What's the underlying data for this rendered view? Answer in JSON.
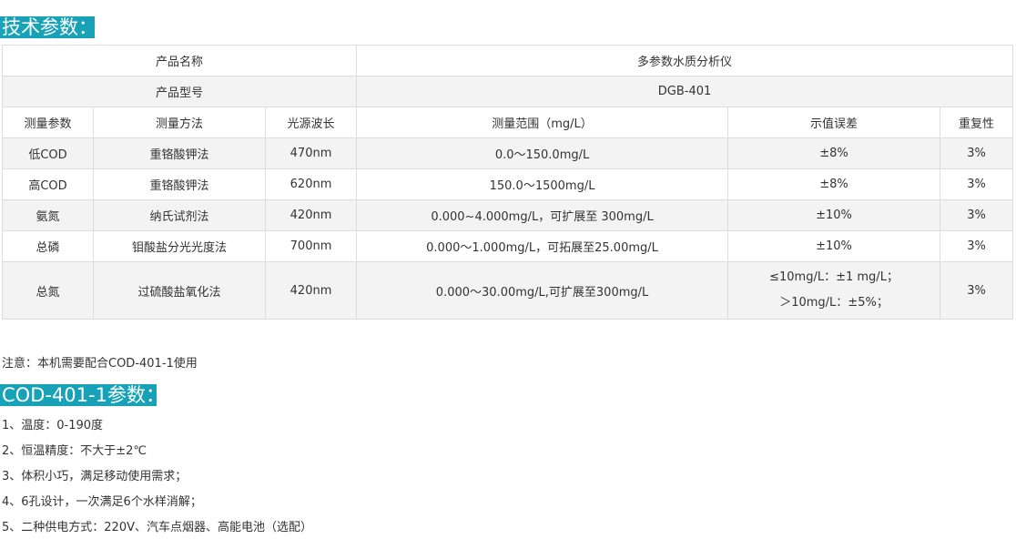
{
  "section1_title": "技术参数：",
  "product_name_label": "产品名称",
  "product_name_value": "多参数水质分析仪",
  "product_model_label": "产品型号",
  "product_model_value": "DGB-401",
  "columns": [
    "测量参数",
    "测量方法",
    "光源波长",
    "测量范围（mg/L）",
    "示值误差",
    "重复性"
  ],
  "rows": [
    {
      "param": "低COD",
      "method": "重铬酸钾法",
      "wavelength": "470nm",
      "range": "0.0～150.0mg/L",
      "error": "±8%",
      "repeat": "3%"
    },
    {
      "param": "高COD",
      "method": "重铬酸钾法",
      "wavelength": "620nm",
      "range": "150.0～1500mg/L",
      "error": "±8%",
      "repeat": "3%"
    },
    {
      "param": "氨氮",
      "method": "纳氏试剂法",
      "wavelength": "420nm",
      "range": "0.000~4.000mg/L，可扩展至 300mg/L",
      "error": "±10%",
      "repeat": "3%"
    },
    {
      "param": "总磷",
      "method": "钼酸盐分光光度法",
      "wavelength": "700nm",
      "range": "0.000～1.000mg/L，可拓展至25.00mg/L",
      "error": "±10%",
      "repeat": "3%"
    },
    {
      "param": "总氮",
      "method": "过硫酸盐氧化法",
      "wavelength": "420nm",
      "range": "0.000～30.00mg/L,可扩展至300mg/L",
      "error_line1": "≤10mg/L：±1 mg/L；",
      "error_line2": "＞10mg/L：±5%；",
      "repeat": "3%"
    }
  ],
  "note": "注意：本机需要配合COD-401-1使用",
  "section2_title": "COD-401-1参数：",
  "items": [
    "1、温度：0-190度",
    "2、恒温精度：不大于±2℃",
    "3、体积小巧，满足移动使用需求；",
    "4、6孔设计，一次满足6个水样消解；",
    "5、二种供电方式：220V、汽车点烟器、高能电池（选配）"
  ]
}
